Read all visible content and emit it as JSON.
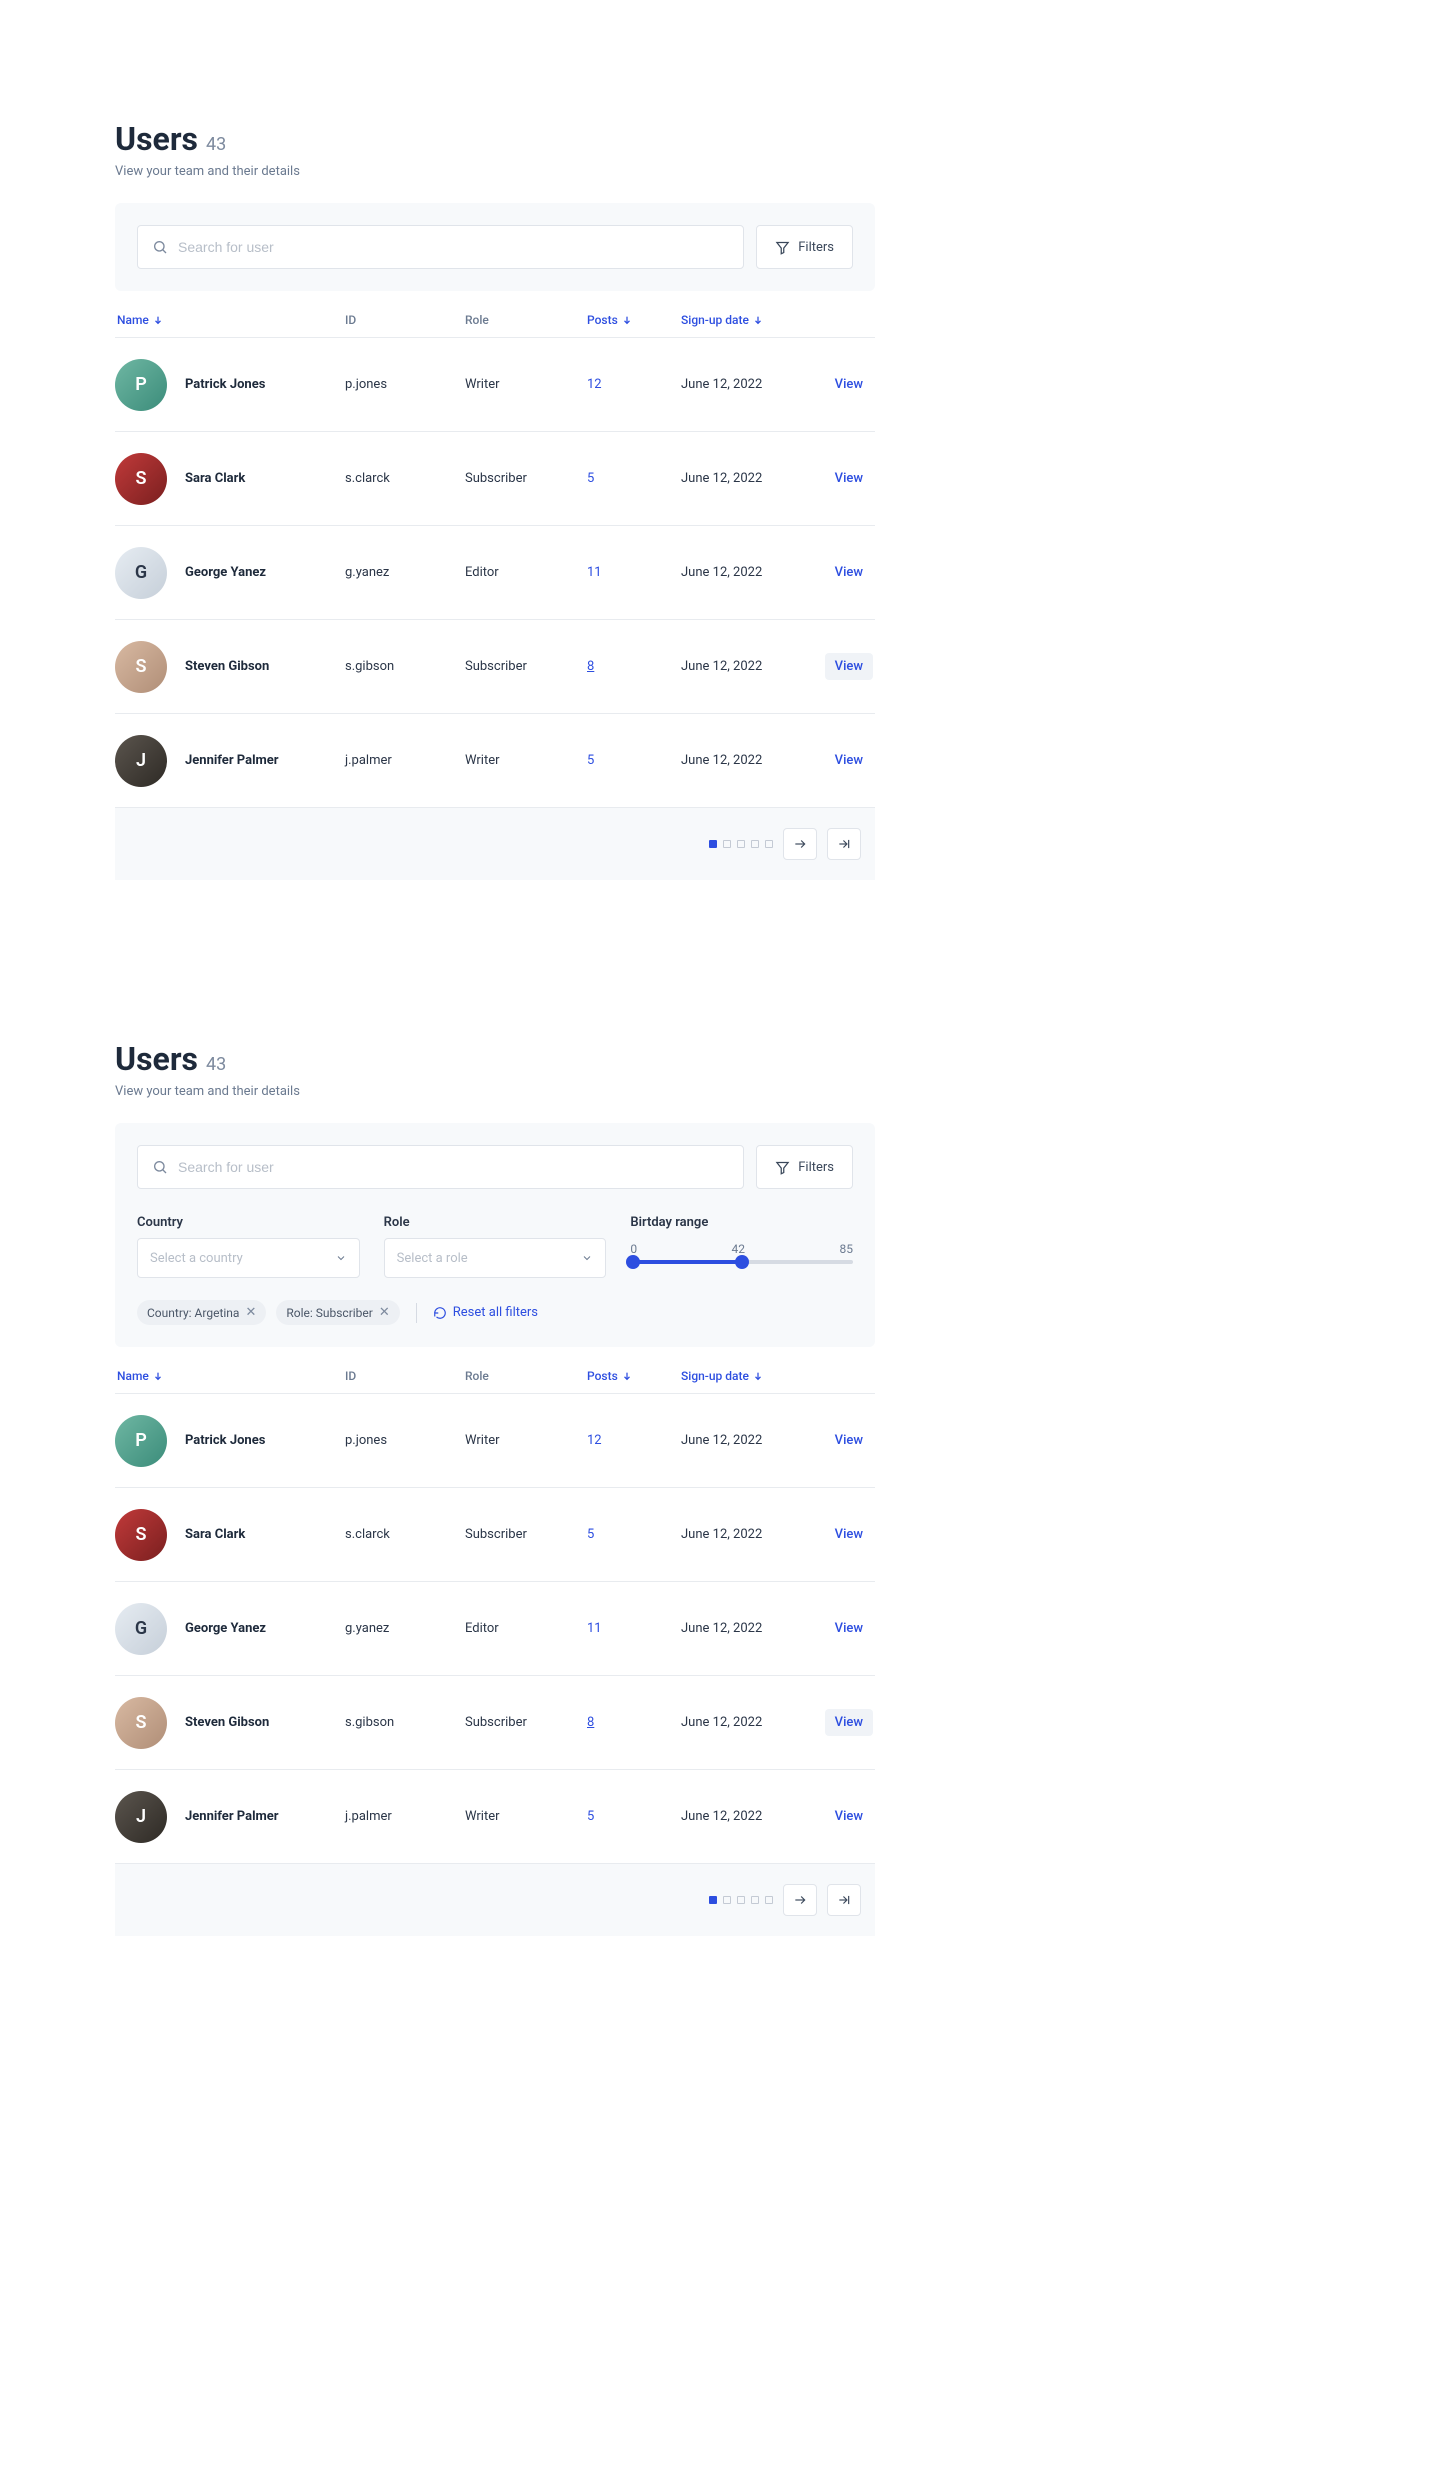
{
  "header": {
    "title": "Users",
    "count": "43",
    "subtitle": "View your team and their details"
  },
  "toolbar": {
    "search_placeholder": "Search for user",
    "filters_label": "Filters"
  },
  "filters": {
    "country_label": "Country",
    "country_placeholder": "Select a country",
    "role_label": "Role",
    "role_placeholder": "Select a role",
    "birthday_label": "Birtday range",
    "birthday_min": "0",
    "birthday_mid": "42",
    "birthday_max": "85",
    "chip_country": "Country: Argetina",
    "chip_role": "Role: Subscriber",
    "reset_label": "Reset all filters"
  },
  "columns": {
    "name": "Name",
    "id": "ID",
    "role": "Role",
    "posts": "Posts",
    "date": "Sign-up date"
  },
  "rows": [
    {
      "name": "Patrick Jones",
      "id": "p.jones",
      "role": "Writer",
      "posts": "12",
      "date": "June 12, 2022",
      "view": "View",
      "underline": false,
      "hl": false,
      "av": "av1",
      "ini": "P"
    },
    {
      "name": "Sara Clark",
      "id": "s.clarck",
      "role": "Subscriber",
      "posts": "5",
      "date": "June 12, 2022",
      "view": "View",
      "underline": false,
      "hl": false,
      "av": "av2",
      "ini": "S"
    },
    {
      "name": "George Yanez",
      "id": "g.yanez",
      "role": "Editor",
      "posts": "11",
      "date": "June 12, 2022",
      "view": "View",
      "underline": false,
      "hl": false,
      "av": "av3",
      "ini": "G"
    },
    {
      "name": "Steven Gibson",
      "id": "s.gibson",
      "role": "Subscriber",
      "posts": "8",
      "date": "June 12, 2022",
      "view": "View",
      "underline": true,
      "hl": true,
      "av": "av4",
      "ini": "S"
    },
    {
      "name": "Jennifer Palmer",
      "id": "j.palmer",
      "role": "Writer",
      "posts": "5",
      "date": "June 12, 2022",
      "view": "View",
      "underline": false,
      "hl": false,
      "av": "av5",
      "ini": "J"
    }
  ]
}
